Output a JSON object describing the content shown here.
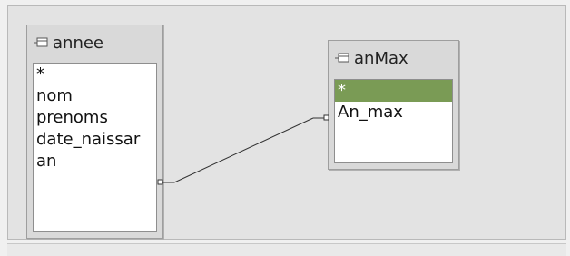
{
  "tables": [
    {
      "title": "annee",
      "fields": [
        "*",
        "nom",
        "prenoms",
        "date_naissar",
        "an"
      ]
    },
    {
      "title": "anMax",
      "fields": [
        "*",
        "An_max"
      ]
    }
  ],
  "colors": {
    "selected_row": "#7a9b55",
    "canvas": "#e3e3e3"
  },
  "icons": [
    "table-icon"
  ]
}
